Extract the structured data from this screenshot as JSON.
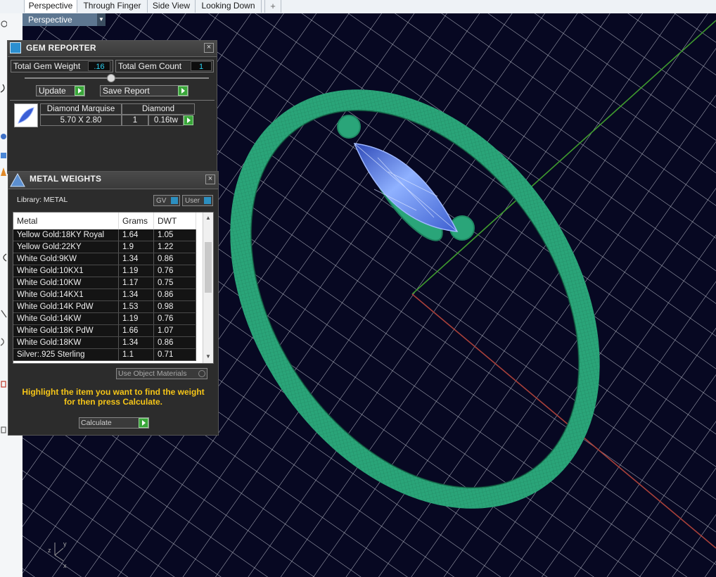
{
  "tabs": [
    "Perspective",
    "Through Finger",
    "Side View",
    "Looking Down"
  ],
  "add_tab_icon": "plus-icon",
  "viewport_label": "Perspective",
  "gem_reporter": {
    "title": "GEM REPORTER",
    "total_weight_label": "Total Gem Weight",
    "total_weight_value": ".16",
    "total_count_label": "Total Gem Count",
    "total_count_value": "1",
    "update_label": "Update",
    "save_label": "Save Report",
    "gem": {
      "name": "Diamond Marquise",
      "material": "Diamond",
      "size": "5.70 X 2.80",
      "qty": "1",
      "weight": "0.16tw"
    }
  },
  "metal_weights": {
    "title": "METAL WEIGHTS",
    "library_label": "Library: METAL",
    "gv_label": "GV",
    "user_label": "User",
    "columns": [
      "Metal",
      "Grams",
      "DWT"
    ],
    "rows": [
      {
        "metal": "Yellow Gold:18KY Royal",
        "grams": "1.64",
        "dwt": "1.05"
      },
      {
        "metal": "Yellow Gold:22KY",
        "grams": "1.9",
        "dwt": "1.22"
      },
      {
        "metal": "White Gold:9KW",
        "grams": "1.34",
        "dwt": "0.86"
      },
      {
        "metal": "White Gold:10KX1",
        "grams": "1.19",
        "dwt": "0.76"
      },
      {
        "metal": "White Gold:10KW",
        "grams": "1.17",
        "dwt": "0.75"
      },
      {
        "metal": "White Gold:14KX1",
        "grams": "1.34",
        "dwt": "0.86"
      },
      {
        "metal": "White Gold:14K PdW",
        "grams": "1.53",
        "dwt": "0.98"
      },
      {
        "metal": "White Gold:14KW",
        "grams": "1.19",
        "dwt": "0.76"
      },
      {
        "metal": "White Gold:18K PdW",
        "grams": "1.66",
        "dwt": "1.07"
      },
      {
        "metal": "White Gold:18KW",
        "grams": "1.34",
        "dwt": "0.86"
      },
      {
        "metal": "Silver:.925 Sterling",
        "grams": "1.1",
        "dwt": "0.71"
      }
    ],
    "use_object_materials": "Use Object Materials",
    "hint": "Highlight the item you want to find the weight for then press Calculate.",
    "calculate_label": "Calculate"
  },
  "axis": {
    "x": "x",
    "y": "y",
    "z": "z"
  },
  "colors": {
    "viewport_bg": "#070822",
    "grid": "#c8cbd6",
    "ring": "#2aa579",
    "gem": "#5d86e6",
    "x_axis": "#a8403a",
    "y_axis": "#3f9a2e",
    "hint": "#f5c518",
    "value": "#2bd0f0",
    "button_green": "#3aa63a"
  }
}
